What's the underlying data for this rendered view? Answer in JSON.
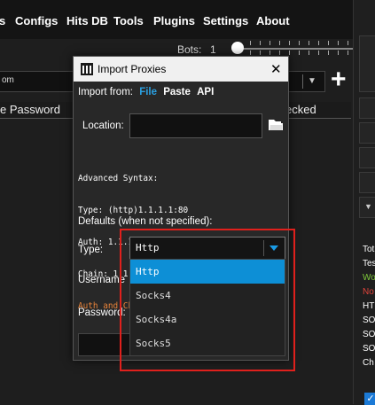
{
  "menubar": {
    "items": [
      "s",
      "Configs",
      "Hits DB",
      "Tools",
      "Plugins",
      "Settings",
      "About"
    ]
  },
  "background": {
    "bots_label": "Bots:",
    "bots_value": "1",
    "top_input_text": "om",
    "plus_label": "+",
    "column_password": "e  Password",
    "column_checked": "ecked",
    "stats": [
      "Tot",
      "Tes",
      "Wo",
      "No",
      "HT",
      "SO",
      "SO",
      "SO",
      "Ch"
    ],
    "stats_colors": [
      "#ffffff",
      "#ffffff",
      "#7ec83a",
      "#e0433a",
      "#ffffff",
      "#ffffff",
      "#ffffff",
      "#ffffff",
      "#ffffff"
    ],
    "checkbox_glyph": "✓"
  },
  "dialog": {
    "title": "Import Proxies",
    "close_glyph": "✕",
    "import_from_label": "Import from:",
    "import_options": [
      "File",
      "Paste",
      "API"
    ],
    "selected_import_option": "File",
    "location_label": "Location:",
    "location_value": "",
    "syntax_lines": [
      {
        "text": "Advanced Syntax:",
        "color": "#ffffff"
      },
      {
        "text": "Type: (http)1.1.1.1:80",
        "color": "#ffffff"
      },
      {
        "text": "Auth: 1.1.1.1:80:username:password",
        "color": "#ffffff"
      },
      {
        "text": "Chain: 1.1.1.1:80 -> 2.2.2.2:80",
        "color": "#ffffff"
      },
      {
        "text": "Auth and Chain won't work with Selenium",
        "color": "#e8833a"
      }
    ],
    "defaults_label": "Defaults (when not specified):",
    "type_label": "Type:",
    "username_label": "Username",
    "password_label": "Password:",
    "type_selected": "Http",
    "type_options": [
      "Http",
      "Socks4",
      "Socks4a",
      "Socks5"
    ]
  },
  "colors": {
    "accent": "#0d8fd6",
    "highlight_box": "#e0201c",
    "warning_text": "#e8833a"
  }
}
